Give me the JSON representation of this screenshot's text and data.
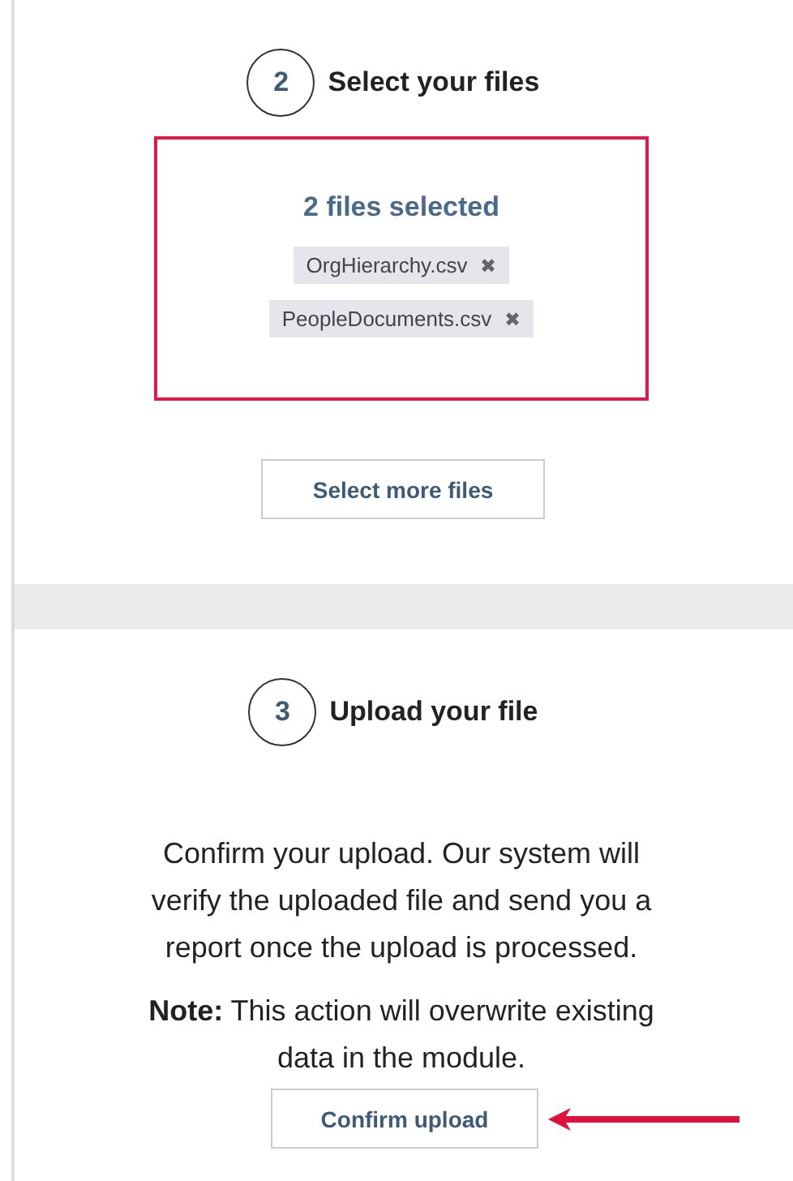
{
  "select_step": {
    "number": "2",
    "title": "Select your files",
    "count_label": "2 files selected",
    "files": [
      {
        "name": "OrgHierarchy.csv",
        "remove": "✖"
      },
      {
        "name": "PeopleDocuments.csv",
        "remove": "✖"
      }
    ],
    "button": "Select more files"
  },
  "upload_step": {
    "number": "3",
    "title": "Upload your file",
    "description": "Confirm your upload. Our system will verify the uploaded file and send you a report once the upload is processed.",
    "note": "**Note:** This action will overwrite existing data in the module.",
    "button": "Confirm upload"
  }
}
